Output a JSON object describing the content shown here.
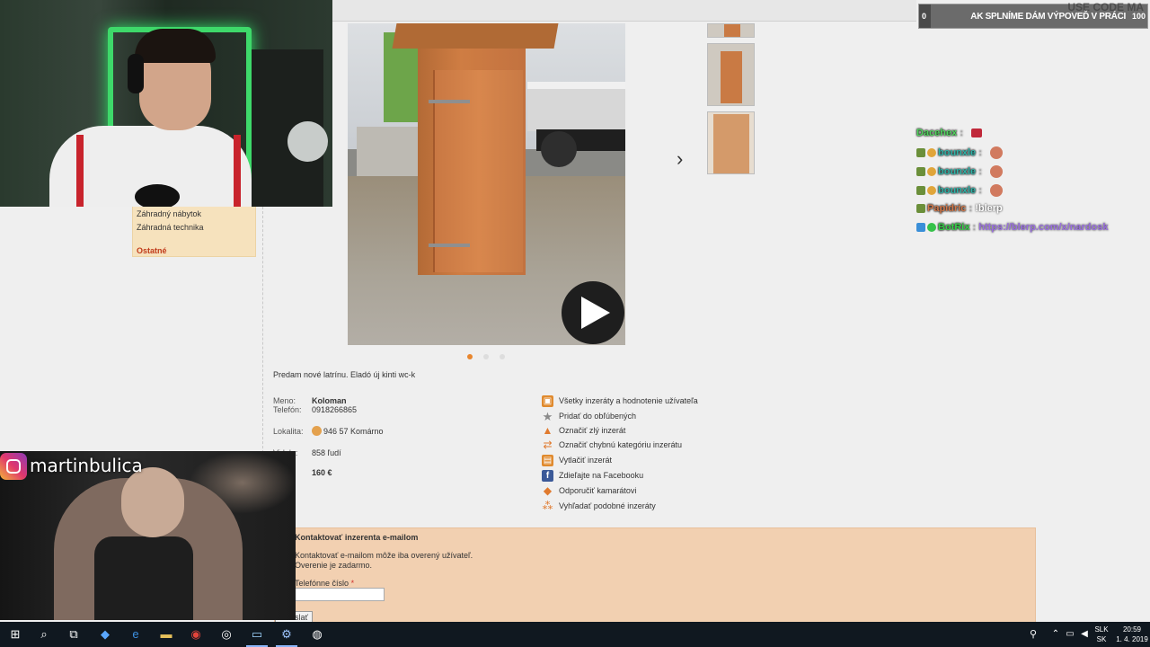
{
  "sidebar": {
    "items": [
      "Záhradný nábytok",
      "Záhradná technika"
    ],
    "other_label": "Ostatné"
  },
  "listing": {
    "description": "Predam nové latrínu. Eladó új kinti wc-k",
    "name_label": "Meno:",
    "name_value": "Koloman",
    "phone_label": "Telefón:",
    "phone_value": "0918266865",
    "location_label": "Lokalita:",
    "location_value": "946 57 Komárno",
    "views_label": "Videlo:",
    "views_value": "858 ľudí",
    "price_value": "160 €",
    "slide_count": 3,
    "active_slide": 1
  },
  "actions": [
    {
      "label": "Všetky inzeráty a hodnotenie užívateľa",
      "icon": "folder-icon",
      "color": "#e08a2e"
    },
    {
      "label": "Pridať do obľúbených",
      "icon": "star-icon",
      "color": "#8a8a8a"
    },
    {
      "label": "Označiť zlý inzerát",
      "icon": "warning-icon",
      "color": "#e07a2e"
    },
    {
      "label": "Označiť chybnú kategóriu inzerátu",
      "icon": "swap-icon",
      "color": "#e07a2e"
    },
    {
      "label": "Vytlačiť inzerát",
      "icon": "print-icon",
      "color": "#e08a2e"
    },
    {
      "label": "Zdieľajte na Facebooku",
      "icon": "facebook-icon",
      "color": "#3b5998"
    },
    {
      "label": "Odporučiť kamarátovi",
      "icon": "recommend-icon",
      "color": "#e07a2e"
    },
    {
      "label": "Vyhľadať podobné inzeráty",
      "icon": "similar-icon",
      "color": "#e07a2e"
    }
  ],
  "contact": {
    "title": "Kontaktovať inzerenta e-mailom",
    "line1": "Kontaktovať e-mailom môže iba overený užívateľ.",
    "line2": "Overenie je zadarmo.",
    "field_label": "Telefónne číslo",
    "required_mark": "*",
    "send_label": "Odoslať"
  },
  "overlay": {
    "instagram_handle": "martinbulica",
    "goal_text": "AK SPLNÍME DÁM VÝPOVEĎ V PRÁCI",
    "goal_min": "0",
    "goal_max": "100",
    "goal_progress": 0.05,
    "goal_top": "USE CODE MA"
  },
  "chat": [
    {
      "user": "Dacehex",
      "message": "",
      "user_color": "#4fd45c",
      "emote": true
    },
    {
      "user": "bounxle",
      "message": "",
      "user_color": "#2eb3a8",
      "emote": true
    },
    {
      "user": "bounxle",
      "message": "",
      "user_color": "#2eb3a8",
      "emote": true
    },
    {
      "user": "bounxle",
      "message": "",
      "user_color": "#2eb3a8",
      "emote": true
    },
    {
      "user": "Papidric",
      "message": "!blerp",
      "user_color": "#d2784a",
      "emote": false
    },
    {
      "user": "BotRix",
      "message": "https://blerp.com/x/nardosk",
      "user_color": "#36d14a",
      "emote": false
    }
  ],
  "taskbar": {
    "language": "SLK",
    "language_sub": "SK",
    "time": "20:59",
    "date": "1. 4. 2019"
  }
}
